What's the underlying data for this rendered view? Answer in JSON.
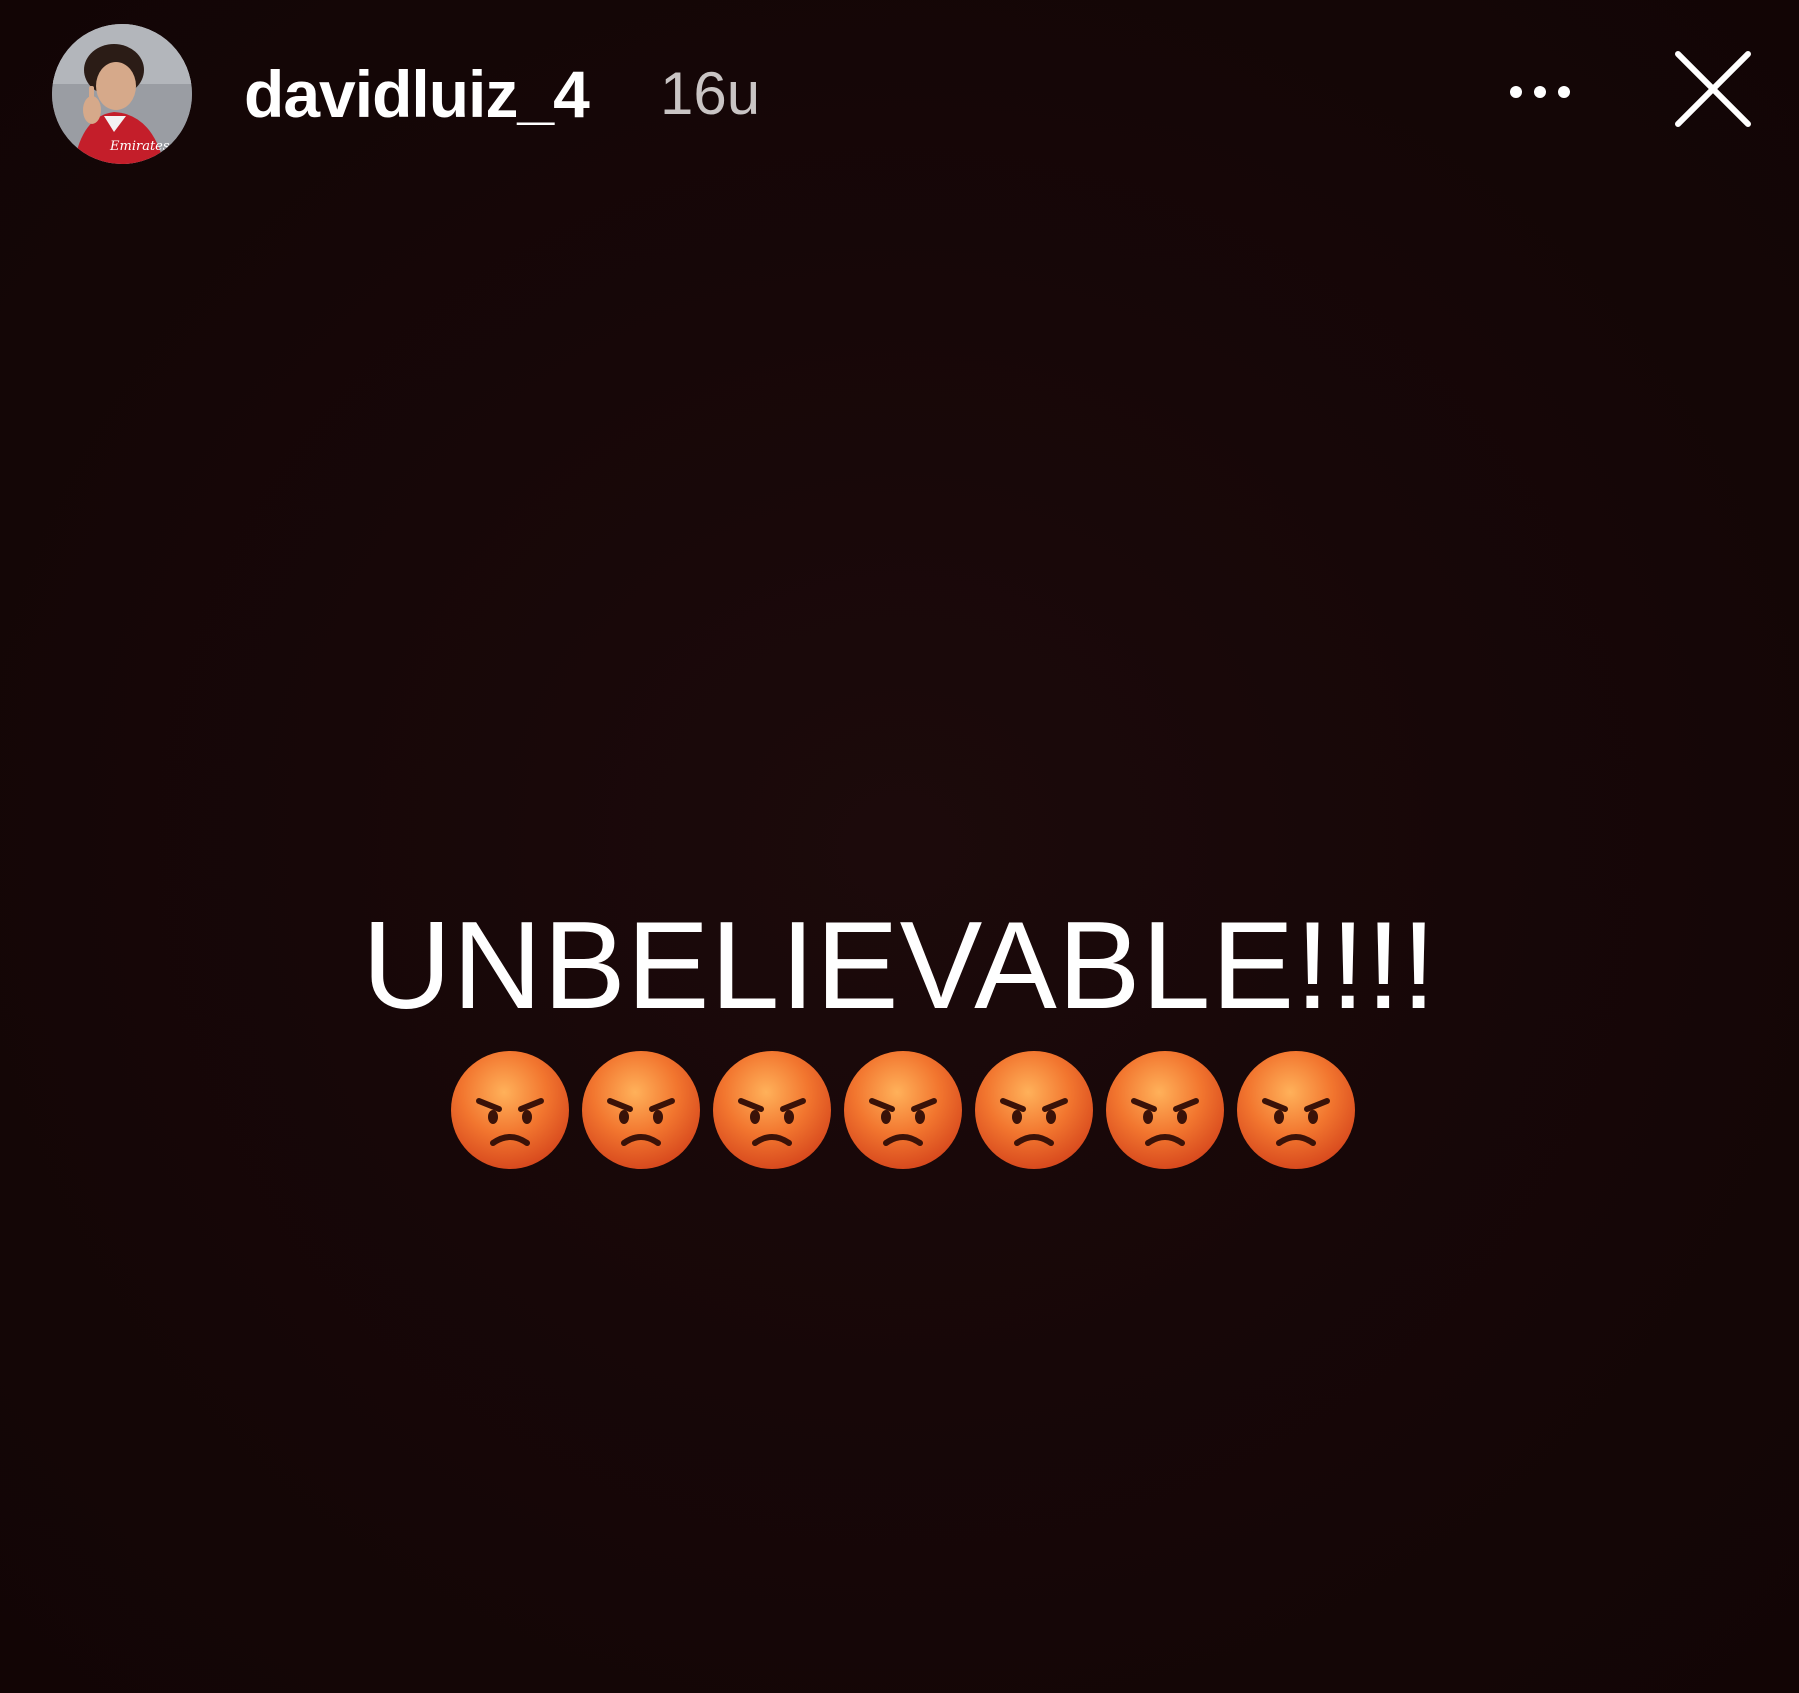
{
  "story": {
    "username": "davidluiz_4",
    "timestamp": "16u",
    "avatar_caption": "Emirates",
    "headline": "UNBELIEVABLE!!!!",
    "emojis": [
      "angry-face",
      "angry-face",
      "angry-face",
      "angry-face",
      "angry-face",
      "angry-face",
      "angry-face"
    ]
  },
  "icons": {
    "more": "more-horizontal-icon",
    "close": "close-icon"
  },
  "colors": {
    "background": "#140606",
    "text": "#ffffff",
    "timestamp": "#c9c4c4",
    "emoji_face": "#f2762f"
  }
}
